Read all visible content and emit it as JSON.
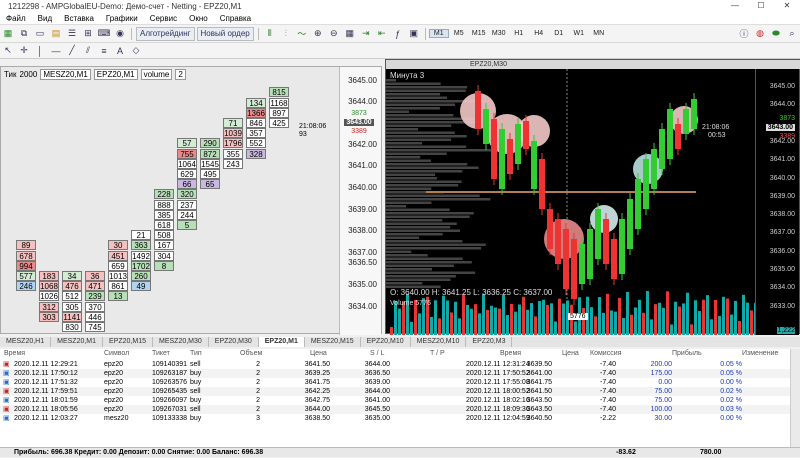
{
  "window": {
    "title": "1212298 - AMPGlobalEU-Demo: Демо-счет - Netting - EPZ20,M1"
  },
  "menu": [
    "Файл",
    "Вид",
    "Вставка",
    "Графики",
    "Сервис",
    "Окно",
    "Справка"
  ],
  "toolbar": {
    "algo": "Алготрейдинг",
    "neworder": "Новый ордер",
    "timeframes": [
      "M1",
      "M5",
      "M15",
      "M30",
      "H1",
      "H4",
      "D1",
      "W1",
      "MN"
    ],
    "active_tf": "M1"
  },
  "tick": {
    "label": "Тик",
    "count": "2000",
    "symbol": "MESZ20,M1",
    "symbol2": "EPZ20,M1",
    "mode": "volume",
    "num": "2"
  },
  "left_axis": [
    "3645.00",
    "3644.00",
    "3643.00",
    "3642.00",
    "3641.00",
    "3640.00",
    "3639.00",
    "3638.00",
    "3637.00",
    "3636.50",
    "3635.00",
    "3634.00"
  ],
  "left_marks": {
    "buy": "3873",
    "price": "3643.00",
    "sell": "3389",
    "time": "21:08:06",
    "count": "93"
  },
  "footprint": [
    {
      "col": 0,
      "row": 17,
      "t": "89",
      "c": "#f4c0c0"
    },
    {
      "col": 0,
      "row": 18,
      "t": "678",
      "c": "#f4c0c0"
    },
    {
      "col": 0,
      "row": 19,
      "t": "994",
      "c": "#e88a8a"
    },
    {
      "col": 0,
      "row": 20,
      "t": "577",
      "c": "#d4ecd4"
    },
    {
      "col": 0,
      "row": 21,
      "t": "246",
      "c": "#b0d4f0"
    },
    {
      "col": 1,
      "row": 20,
      "t": "183",
      "c": "#f4c0c0"
    },
    {
      "col": 1,
      "row": 21,
      "t": "1068",
      "c": "#f4c0c0"
    },
    {
      "col": 1,
      "row": 22,
      "t": "1026",
      "c": "#fff"
    },
    {
      "col": 1,
      "row": 23,
      "t": "312",
      "c": "#f4c0c0"
    },
    {
      "col": 1,
      "row": 24,
      "t": "303",
      "c": "#f4c0c0"
    },
    {
      "col": 2,
      "row": 20,
      "t": "34",
      "c": "#d4ecd4"
    },
    {
      "col": 2,
      "row": 21,
      "t": "476",
      "c": "#f4c0c0"
    },
    {
      "col": 2,
      "row": 22,
      "t": "512",
      "c": "#fff"
    },
    {
      "col": 2,
      "row": 23,
      "t": "305",
      "c": "#fff"
    },
    {
      "col": 2,
      "row": 24,
      "t": "1141",
      "c": "#f4c0c0"
    },
    {
      "col": 2,
      "row": 25,
      "t": "830",
      "c": "#fff"
    },
    {
      "col": 3,
      "row": 20,
      "t": "36",
      "c": "#f4c0c0"
    },
    {
      "col": 3,
      "row": 21,
      "t": "471",
      "c": "#f4c0c0"
    },
    {
      "col": 3,
      "row": 22,
      "t": "239",
      "c": "#b8e0b8"
    },
    {
      "col": 3,
      "row": 23,
      "t": "370",
      "c": "#fff"
    },
    {
      "col": 3,
      "row": 24,
      "t": "446",
      "c": "#fff"
    },
    {
      "col": 3,
      "row": 25,
      "t": "745",
      "c": "#fff"
    },
    {
      "col": 4,
      "row": 17,
      "t": "30",
      "c": "#f4c0c0"
    },
    {
      "col": 4,
      "row": 18,
      "t": "451",
      "c": "#f4c0c0"
    },
    {
      "col": 4,
      "row": 19,
      "t": "659",
      "c": "#fff"
    },
    {
      "col": 4,
      "row": 20,
      "t": "1013",
      "c": "#fff"
    },
    {
      "col": 4,
      "row": 21,
      "t": "861",
      "c": "#fff"
    },
    {
      "col": 4,
      "row": 22,
      "t": "13",
      "c": "#b8e0b8"
    },
    {
      "col": 5,
      "row": 16,
      "t": "21",
      "c": "#fff"
    },
    {
      "col": 5,
      "row": 17,
      "t": "363",
      "c": "#b8e0b8"
    },
    {
      "col": 5,
      "row": 18,
      "t": "1492",
      "c": "#fff"
    },
    {
      "col": 5,
      "row": 19,
      "t": "1702",
      "c": "#b8e0b8"
    },
    {
      "col": 5,
      "row": 20,
      "t": "260",
      "c": "#b8e0b8"
    },
    {
      "col": 5,
      "row": 21,
      "t": "49",
      "c": "#b0d4f0"
    },
    {
      "col": 6,
      "row": 12,
      "t": "228",
      "c": "#b8e0b8"
    },
    {
      "col": 6,
      "row": 13,
      "t": "888",
      "c": "#fff"
    },
    {
      "col": 6,
      "row": 14,
      "t": "385",
      "c": "#fff"
    },
    {
      "col": 6,
      "row": 15,
      "t": "618",
      "c": "#fff"
    },
    {
      "col": 6,
      "row": 16,
      "t": "508",
      "c": "#fff"
    },
    {
      "col": 6,
      "row": 17,
      "t": "167",
      "c": "#fff"
    },
    {
      "col": 6,
      "row": 18,
      "t": "304",
      "c": "#fff"
    },
    {
      "col": 6,
      "row": 19,
      "t": "8",
      "c": "#b8e0b8"
    },
    {
      "col": 7,
      "row": 12,
      "t": "320",
      "c": "#b8e0b8"
    },
    {
      "col": 7,
      "row": 13,
      "t": "237",
      "c": "#fff"
    },
    {
      "col": 7,
      "row": 14,
      "t": "244",
      "c": "#fff"
    },
    {
      "col": 7,
      "row": 15,
      "t": "5",
      "c": "#b8e0b8"
    },
    {
      "col": 7,
      "row": 7,
      "t": "57",
      "c": "#d4ecd4"
    },
    {
      "col": 7,
      "row": 8,
      "t": "755",
      "c": "#e88a8a"
    },
    {
      "col": 7,
      "row": 9,
      "t": "1064",
      "c": "#fff"
    },
    {
      "col": 7,
      "row": 10,
      "t": "629",
      "c": "#fff"
    },
    {
      "col": 7,
      "row": 11,
      "t": "66",
      "c": "#c9b8e0"
    },
    {
      "col": 8,
      "row": 7,
      "t": "290",
      "c": "#b8e0b8"
    },
    {
      "col": 8,
      "row": 8,
      "t": "872",
      "c": "#b8e0b8"
    },
    {
      "col": 8,
      "row": 9,
      "t": "1545",
      "c": "#fff"
    },
    {
      "col": 8,
      "row": 10,
      "t": "495",
      "c": "#fff"
    },
    {
      "col": 8,
      "row": 11,
      "t": "65",
      "c": "#c9b8e0"
    },
    {
      "col": 9,
      "row": 5,
      "t": "71",
      "c": "#d4ecd4"
    },
    {
      "col": 9,
      "row": 6,
      "t": "1039",
      "c": "#f4c0c0"
    },
    {
      "col": 9,
      "row": 7,
      "t": "1796",
      "c": "#f4c0c0"
    },
    {
      "col": 9,
      "row": 8,
      "t": "355",
      "c": "#fff"
    },
    {
      "col": 9,
      "row": 9,
      "t": "243",
      "c": "#fff"
    },
    {
      "col": 10,
      "row": 3,
      "t": "134",
      "c": "#d4ecd4"
    },
    {
      "col": 10,
      "row": 4,
      "t": "1366",
      "c": "#e88a8a"
    },
    {
      "col": 10,
      "row": 5,
      "t": "846",
      "c": "#fff"
    },
    {
      "col": 10,
      "row": 6,
      "t": "357",
      "c": "#fff"
    },
    {
      "col": 10,
      "row": 7,
      "t": "552",
      "c": "#fff"
    },
    {
      "col": 10,
      "row": 8,
      "t": "328",
      "c": "#c9b8e0"
    },
    {
      "col": 11,
      "row": 2,
      "t": "815",
      "c": "#b8e0b8"
    },
    {
      "col": 11,
      "row": 3,
      "t": "1168",
      "c": "#fff"
    },
    {
      "col": 11,
      "row": 4,
      "t": "897",
      "c": "#fff"
    },
    {
      "col": 11,
      "row": 5,
      "t": "425",
      "c": "#fff"
    }
  ],
  "chart": {
    "title": "EPZ20,M30",
    "header": "Минута  3",
    "time": "21:08:06",
    "timer": "00:53",
    "buy": "3873",
    "price": "3643.00",
    "sell": "3389",
    "axis": [
      "3645.00",
      "3644.00",
      "3643.00",
      "3642.00",
      "3641.00",
      "3640.00",
      "3639.00",
      "3638.00",
      "3637.00",
      "3636.00",
      "3635.00",
      "3634.00",
      "3633.00"
    ],
    "ohlc": "O: 3640.00  H: 3641.25  L: 3636.25  C: 3637.00",
    "volume_label": "Volume  5776",
    "volume_tag": "5776",
    "volume_end": "1,222"
  },
  "tabs": [
    "MESZ20,H1",
    "MESZ20,M1",
    "EPZ20,M15",
    "MESZ20,M30",
    "EPZ20,M30",
    "EPZ20,M1",
    "MESZ20,M15",
    "EPZ20,M10",
    "MESZ20,M10",
    "EPZ20,M3"
  ],
  "active_tab": "EPZ20,M1",
  "table": {
    "headers": [
      "Время",
      "Символ",
      "Тикет",
      "Тип",
      "Объем",
      "Цена",
      "S / L",
      "T / P",
      "Время",
      "Цена",
      "Комиссия",
      "Прибыль",
      "Изменение"
    ],
    "rows": [
      [
        "2020.12.11 12:29:21",
        "epz20",
        "109140391",
        "sell",
        "2",
        "3641.50",
        "3644.00",
        "",
        "2020.12.11 12:31:24",
        "3639.50",
        "-7.40",
        "200.00",
        "0.05 %"
      ],
      [
        "2020.12.11 17:50:12",
        "epz20",
        "109263187",
        "buy",
        "2",
        "3639.25",
        "3636.50",
        "",
        "2020.12.11 17:50:52",
        "3641.00",
        "-7.40",
        "175.00",
        "0.05 %"
      ],
      [
        "2020.12.11 17:51:32",
        "epz20",
        "109263576",
        "buy",
        "2",
        "3641.75",
        "3639.00",
        "",
        "2020.12.11 17:55:08",
        "3641.75",
        "-7.40",
        "0.00",
        "0.00 %"
      ],
      [
        "2020.12.11 17:59:51",
        "epz20",
        "109265435",
        "sell",
        "2",
        "3642.25",
        "3644.00",
        "",
        "2020.12.11 18:00:52",
        "3641.50",
        "-7.40",
        "75.00",
        "0.02 %"
      ],
      [
        "2020.12.11 18:01:59",
        "epz20",
        "109266097",
        "buy",
        "2",
        "3642.75",
        "3641.00",
        "",
        "2020.12.11 18:02:16",
        "3643.50",
        "-7.40",
        "75.00",
        "0.02 %"
      ],
      [
        "2020.12.11 18:05:56",
        "epz20",
        "109267031",
        "sell",
        "2",
        "3644.00",
        "3645.50",
        "",
        "2020.12.11 18:09:36",
        "3643.50",
        "-7.40",
        "100.00",
        "0.03 %"
      ],
      [
        "2020.12.11 12:03:27",
        "mesz20",
        "109133338",
        "buy",
        "3",
        "3638.50",
        "3635.00",
        "",
        "2020.12.11 12:04:59",
        "3640.50",
        "-2.22",
        "30.00",
        "0.00 %"
      ]
    ]
  },
  "status": {
    "summary": "Прибыль: 696.38  Кредит: 0.00  Депозит: 0.00  Снятие: 0.00  Баланс: 696.38",
    "commission": "-83.62",
    "profit": "780.00"
  }
}
